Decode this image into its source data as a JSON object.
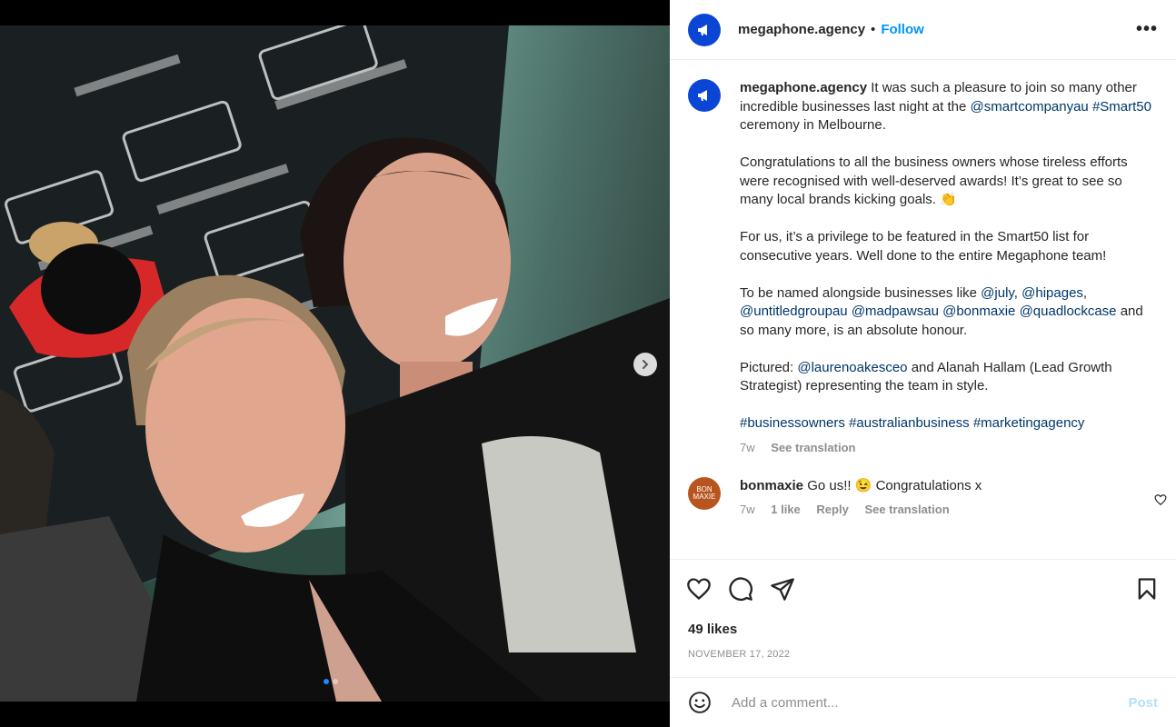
{
  "post": {
    "username": "megaphone.agency",
    "separator": "•",
    "follow_label": "Follow",
    "more_label": "•••",
    "caption": {
      "username": "megaphone.agency",
      "p1_text": "It was such a pleasure to join so many other incredible businesses last night at the",
      "p1_mention": "@smartcompanyau",
      "p1_hashtag": "#Smart50",
      "p1_end": "ceremony in Melbourne.",
      "p2": "Congratulations to all the business owners whose tireless efforts were recognised with well-deserved awards! It’s great to see so many local brands kicking goals. 👏",
      "p3": "For us, it’s a privilege to be featured in the Smart50 list for consecutive years. Well done to the entire Megaphone team!",
      "p4_start": "To be named alongside businesses like",
      "p4_mentions": [
        "@july",
        "@hipages",
        "@untitledgroupau",
        "@madpawsau",
        "@bonmaxie",
        "@quadlockcase"
      ],
      "p4_end": "and so many more, is an absolute honour.",
      "p5_start": "Pictured:",
      "p5_mention": "@laurenoakesceo",
      "p5_end": "and Alanah Hallam (Lead Growth Strategist) representing the team in style.",
      "hashtags": [
        "#businessowners",
        "#australianbusiness",
        "#marketingagency"
      ],
      "time": "7w",
      "see_translation": "See translation"
    },
    "comments": [
      {
        "username": "bonmaxie",
        "avatar_text": "BON MAXIE",
        "text": "Go us!! 😉 Congratulations x",
        "time": "7w",
        "likes": "1 like",
        "reply": "Reply",
        "see_translation": "See translation"
      }
    ],
    "likes": "49 likes",
    "date": "NOVEMBER 17, 2022",
    "add_comment_placeholder": "Add a comment...",
    "post_label": "Post"
  },
  "media": {
    "carousel_count": 2,
    "carousel_active": 0
  },
  "colors": {
    "brand_blue": "#0a45d6",
    "link": "#00376b",
    "follow": "#0095f6",
    "muted": "#8e8e8e"
  }
}
